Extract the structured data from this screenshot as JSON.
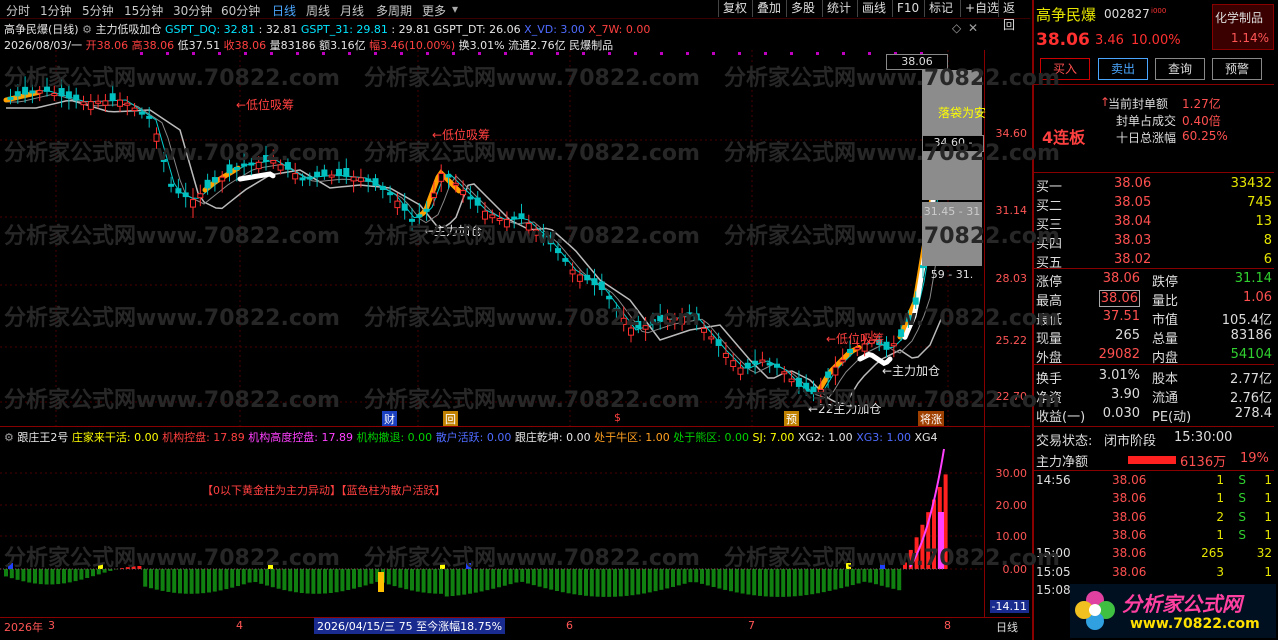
{
  "toolbar": {
    "periods": [
      "分时",
      "1分钟",
      "5分钟",
      "15分钟",
      "30分钟",
      "60分钟",
      "日线",
      "周线",
      "月线",
      "多周期",
      "更多"
    ],
    "active_period": "日线",
    "right_buttons": [
      "复权",
      "叠加",
      "多股",
      "统计",
      "画线",
      "F10",
      "标记",
      "+自选",
      "返回"
    ]
  },
  "chart_header": {
    "title": "高争民爆(日线)",
    "indicator": "主力低吸加仓",
    "gspt_dq_label": "GSPT_DQ: 32.81",
    "gspt_dq_val": ": 32.81",
    "gspt_31_label": "GSPT_31: 29.81",
    "gspt_31_val": ": 29.81",
    "gspt_dt_label": "GSPT_DT: 26.06",
    "x_vd_label": "X_VD: 3.00",
    "x_7w_label": "X_7W: 0.00",
    "ohlc_date": "2026/08/03/一",
    "ohlc_open": "开38.06",
    "ohlc_high": "高38.06",
    "ohlc_low": "低37.51",
    "ohlc_close": "收38.06",
    "ohlc_vol": "量83186",
    "ohlc_amt": "额3.16亿",
    "ohlc_pct": "幅3.46(10.00%)",
    "ohlc_turn": "换3.01%",
    "ohlc_float": "流通2.76亿",
    "ohlc_sector": "民爆制品"
  },
  "price_axis": [
    "34.60",
    "31.14",
    "28.03",
    "25.22",
    "22.70"
  ],
  "price_boxes": {
    "top": "38.06",
    "p1": "34.60 -",
    "p2": "31.45 - 31",
    "p3": "59 - 31."
  },
  "annotations": {
    "low_suck_1": "←低位吸筹",
    "low_suck_2": "←低位吸筹",
    "low_suck_3": "←低位吸筹",
    "add_pos_1": "←主力加仓",
    "add_pos_2": "←主力加仓",
    "add_pos_3": "←22主力加仓",
    "pocket": "落袋为安",
    "tag_cai": "财",
    "tag_hui": "回",
    "tag_yu": "预",
    "tag_zhang": "将涨"
  },
  "sub_header": {
    "name": "跟庄王2号",
    "z1": "庄家来干活: 0.00",
    "z2": "机构控盘: 17.89",
    "z3": "机构高度控盘: 17.89",
    "z4": "机构撤退: 0.00",
    "z5": "散户活跃: 0.00",
    "z6": "跟庄乾坤: 0.00",
    "z7": "处于牛区: 1.00",
    "z8": "处于熊区: 0.00",
    "z9": "SJ: 7.00",
    "z10": "XG2: 1.00",
    "z11": "XG3: 1.00",
    "z12": "XG4"
  },
  "sub_note": "【0以下黄金柱为主力异动】【蓝色柱为散户活跃】",
  "sub_axis": [
    "30.00",
    "20.00",
    "10.00",
    "0.00"
  ],
  "sub_axis_neg": "-14.11",
  "date_axis": {
    "year": "2026年",
    "m3": "3",
    "m4": "4",
    "m5": "5",
    "m6": "6",
    "m7": "7",
    "m8": "8",
    "info": "2026/04/15/三 75 至今涨幅18.75%",
    "period": "日线"
  },
  "quote": {
    "name": "高争民爆",
    "code": "002827",
    "sector": "化学制品",
    "sector_pct": "1.14%",
    "price": "38.06",
    "change": "3.46",
    "pct": "10.00%",
    "buy_btn": "买入",
    "sell_btn": "卖出",
    "query_btn": "查询",
    "alert_btn": "预警",
    "lianban": "4连板",
    "seal_amt_label": "当前封单额",
    "seal_amt": "1.27亿",
    "seal_ratio_label": "封单占成交",
    "seal_ratio": "0.40倍",
    "ten_day_label": "十日总涨幅",
    "ten_day": "60.25%",
    "bids": [
      {
        "label": "买一",
        "price": "38.06",
        "vol": "33432"
      },
      {
        "label": "买二",
        "price": "38.05",
        "vol": "745"
      },
      {
        "label": "买三",
        "price": "38.04",
        "vol": "13"
      },
      {
        "label": "买四",
        "price": "38.03",
        "vol": "8"
      },
      {
        "label": "买五",
        "price": "38.02",
        "vol": "6"
      }
    ],
    "stats": [
      {
        "l1": "涨停",
        "v1": "38.06",
        "l2": "跌停",
        "v2": "31.14"
      },
      {
        "l1": "最高",
        "v1": "38.06",
        "l2": "量比",
        "v2": "1.06"
      },
      {
        "l1": "最低",
        "v1": "37.51",
        "l2": "市值",
        "v2": "105.4亿"
      },
      {
        "l1": "现量",
        "v1": "265",
        "l2": "总量",
        "v2": "83186"
      },
      {
        "l1": "外盘",
        "v1": "29082",
        "l2": "内盘",
        "v2": "54104"
      }
    ],
    "stats2": [
      {
        "l1": "换手",
        "v1": "3.01%",
        "l2": "股本",
        "v2": "2.77亿"
      },
      {
        "l1": "净资",
        "v1": "3.90",
        "l2": "流通",
        "v2": "2.76亿"
      },
      {
        "l1": "收益(一)",
        "v1": "0.030",
        "l2": "PE(动)",
        "v2": "278.4"
      }
    ],
    "trade_state_label": "交易状态:",
    "trade_state": "闭市阶段",
    "trade_time": "15:30:00",
    "net_flow_label": "主力净额",
    "net_flow": "6136万",
    "net_flow_pct": "19%",
    "ticks": [
      {
        "t": "14:56",
        "p": "38.06",
        "v": "1",
        "s": "S",
        "n": "1"
      },
      {
        "t": "",
        "p": "38.06",
        "v": "1",
        "s": "S",
        "n": "1"
      },
      {
        "t": "",
        "p": "38.06",
        "v": "2",
        "s": "S",
        "n": "1"
      },
      {
        "t": "",
        "p": "38.06",
        "v": "1",
        "s": "S",
        "n": "1"
      },
      {
        "t": "15:00",
        "p": "38.06",
        "v": "265",
        "s": "",
        "n": "32"
      },
      {
        "t": "15:05",
        "p": "38.06",
        "v": "3",
        "s": "",
        "n": "1"
      },
      {
        "t": "15:08",
        "p": "",
        "v": "",
        "s": "",
        "n": ""
      }
    ]
  },
  "brand": {
    "name": "分析家公式网",
    "url": "www.70822.com"
  },
  "watermark": "分析家公式网www.70822.com"
}
